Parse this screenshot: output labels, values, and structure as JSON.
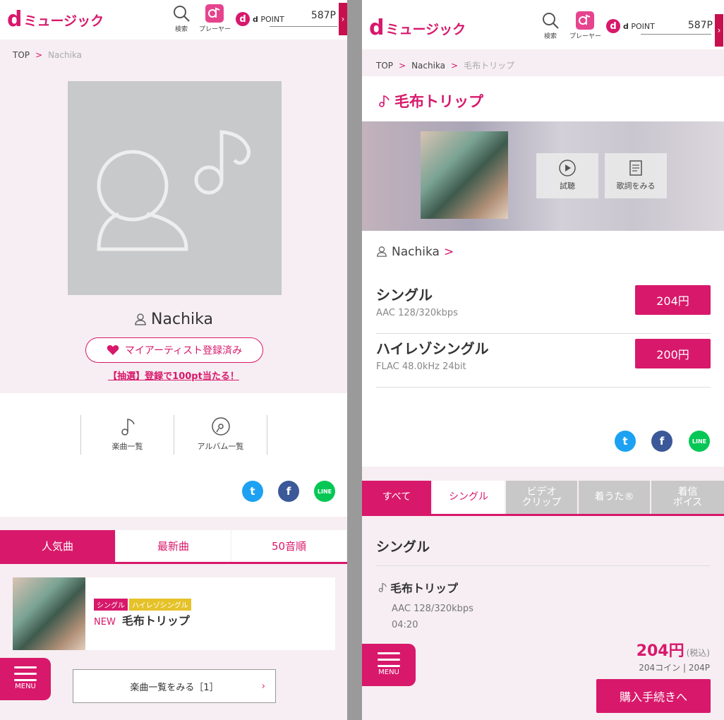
{
  "colors": {
    "accent": "#d8186b",
    "twitter": "#1da1f2",
    "facebook": "#3b5998",
    "line": "#06c755"
  },
  "header": {
    "logo_d": "d",
    "logo_text": "ミュージック",
    "search_label": "検索",
    "player_label": "プレーヤー",
    "dpoint_d": "d",
    "dpoint_label": "POINT",
    "points": "587P",
    "points_tab": "›"
  },
  "left": {
    "breadcrumb": {
      "top": "TOP",
      "sep1": ">",
      "current": "Nachika"
    },
    "artist_name": "Nachika",
    "fav_label": "マイアーティスト登録済み",
    "lottery_link": "【抽選】登録で100pt当たる！",
    "nav": {
      "songs_label": "楽曲一覧",
      "albums_label": "アルバム一覧"
    },
    "social": {
      "twitter": "t",
      "facebook": "f",
      "line": "LINE"
    },
    "tabs": [
      "人気曲",
      "最新曲",
      "50音順"
    ],
    "song": {
      "badge_single": "シングル",
      "badge_hires": "ハイレゾシングル",
      "new_label": "NEW",
      "title": "毛布トリップ"
    },
    "menu_label": "MENU",
    "see_all": "楽曲一覧をみる［1］",
    "see_all_chev": "›"
  },
  "right": {
    "breadcrumb": {
      "top": "TOP",
      "sep1": ">",
      "artist": "Nachika",
      "sep2": ">",
      "current": "毛布トリップ"
    },
    "song_title": "毛布トリップ",
    "preview_label": "試聴",
    "lyrics_label": "歌詞をみる",
    "artist_name": "Nachika",
    "artist_chev": ">",
    "formats": [
      {
        "name": "シングル",
        "desc": "AAC 128/320kbps",
        "price": "204円"
      },
      {
        "name": "ハイレゾシングル",
        "desc": "FLAC 48.0kHz 24bit",
        "price": "200円"
      }
    ],
    "social": {
      "twitter": "t",
      "facebook": "f",
      "line": "LINE"
    },
    "tabs": {
      "all": "すべて",
      "single": "シングル",
      "video_l1": "ビデオ",
      "video_l2": "クリップ",
      "chaku": "着うた®",
      "voice_l1": "着信",
      "voice_l2": "ボイス"
    },
    "section_title": "シングル",
    "track": {
      "name": "毛布トリップ",
      "format": "AAC 128/320kbps",
      "duration": "04:20",
      "price": "204円",
      "tax": "(税込)",
      "coin": "204コイン | 204P"
    },
    "menu_label": "MENU",
    "buy_label": "購入手続きへ"
  }
}
